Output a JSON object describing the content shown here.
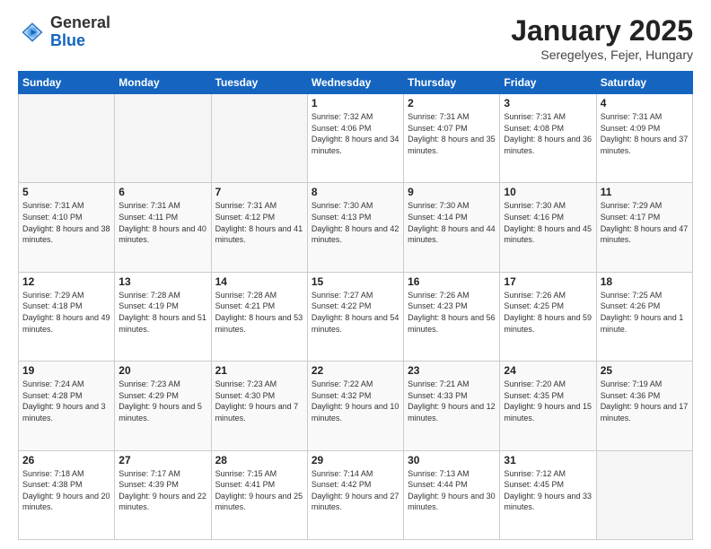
{
  "logo": {
    "general": "General",
    "blue": "Blue"
  },
  "title": "January 2025",
  "location": "Seregelyes, Fejer, Hungary",
  "days_of_week": [
    "Sunday",
    "Monday",
    "Tuesday",
    "Wednesday",
    "Thursday",
    "Friday",
    "Saturday"
  ],
  "weeks": [
    [
      {
        "num": "",
        "sunrise": "",
        "sunset": "",
        "daylight": "",
        "empty": true
      },
      {
        "num": "",
        "sunrise": "",
        "sunset": "",
        "daylight": "",
        "empty": true
      },
      {
        "num": "",
        "sunrise": "",
        "sunset": "",
        "daylight": "",
        "empty": true
      },
      {
        "num": "1",
        "sunrise": "Sunrise: 7:32 AM",
        "sunset": "Sunset: 4:06 PM",
        "daylight": "Daylight: 8 hours and 34 minutes."
      },
      {
        "num": "2",
        "sunrise": "Sunrise: 7:31 AM",
        "sunset": "Sunset: 4:07 PM",
        "daylight": "Daylight: 8 hours and 35 minutes."
      },
      {
        "num": "3",
        "sunrise": "Sunrise: 7:31 AM",
        "sunset": "Sunset: 4:08 PM",
        "daylight": "Daylight: 8 hours and 36 minutes."
      },
      {
        "num": "4",
        "sunrise": "Sunrise: 7:31 AM",
        "sunset": "Sunset: 4:09 PM",
        "daylight": "Daylight: 8 hours and 37 minutes."
      }
    ],
    [
      {
        "num": "5",
        "sunrise": "Sunrise: 7:31 AM",
        "sunset": "Sunset: 4:10 PM",
        "daylight": "Daylight: 8 hours and 38 minutes."
      },
      {
        "num": "6",
        "sunrise": "Sunrise: 7:31 AM",
        "sunset": "Sunset: 4:11 PM",
        "daylight": "Daylight: 8 hours and 40 minutes."
      },
      {
        "num": "7",
        "sunrise": "Sunrise: 7:31 AM",
        "sunset": "Sunset: 4:12 PM",
        "daylight": "Daylight: 8 hours and 41 minutes."
      },
      {
        "num": "8",
        "sunrise": "Sunrise: 7:30 AM",
        "sunset": "Sunset: 4:13 PM",
        "daylight": "Daylight: 8 hours and 42 minutes."
      },
      {
        "num": "9",
        "sunrise": "Sunrise: 7:30 AM",
        "sunset": "Sunset: 4:14 PM",
        "daylight": "Daylight: 8 hours and 44 minutes."
      },
      {
        "num": "10",
        "sunrise": "Sunrise: 7:30 AM",
        "sunset": "Sunset: 4:16 PM",
        "daylight": "Daylight: 8 hours and 45 minutes."
      },
      {
        "num": "11",
        "sunrise": "Sunrise: 7:29 AM",
        "sunset": "Sunset: 4:17 PM",
        "daylight": "Daylight: 8 hours and 47 minutes."
      }
    ],
    [
      {
        "num": "12",
        "sunrise": "Sunrise: 7:29 AM",
        "sunset": "Sunset: 4:18 PM",
        "daylight": "Daylight: 8 hours and 49 minutes."
      },
      {
        "num": "13",
        "sunrise": "Sunrise: 7:28 AM",
        "sunset": "Sunset: 4:19 PM",
        "daylight": "Daylight: 8 hours and 51 minutes."
      },
      {
        "num": "14",
        "sunrise": "Sunrise: 7:28 AM",
        "sunset": "Sunset: 4:21 PM",
        "daylight": "Daylight: 8 hours and 53 minutes."
      },
      {
        "num": "15",
        "sunrise": "Sunrise: 7:27 AM",
        "sunset": "Sunset: 4:22 PM",
        "daylight": "Daylight: 8 hours and 54 minutes."
      },
      {
        "num": "16",
        "sunrise": "Sunrise: 7:26 AM",
        "sunset": "Sunset: 4:23 PM",
        "daylight": "Daylight: 8 hours and 56 minutes."
      },
      {
        "num": "17",
        "sunrise": "Sunrise: 7:26 AM",
        "sunset": "Sunset: 4:25 PM",
        "daylight": "Daylight: 8 hours and 59 minutes."
      },
      {
        "num": "18",
        "sunrise": "Sunrise: 7:25 AM",
        "sunset": "Sunset: 4:26 PM",
        "daylight": "Daylight: 9 hours and 1 minute."
      }
    ],
    [
      {
        "num": "19",
        "sunrise": "Sunrise: 7:24 AM",
        "sunset": "Sunset: 4:28 PM",
        "daylight": "Daylight: 9 hours and 3 minutes."
      },
      {
        "num": "20",
        "sunrise": "Sunrise: 7:23 AM",
        "sunset": "Sunset: 4:29 PM",
        "daylight": "Daylight: 9 hours and 5 minutes."
      },
      {
        "num": "21",
        "sunrise": "Sunrise: 7:23 AM",
        "sunset": "Sunset: 4:30 PM",
        "daylight": "Daylight: 9 hours and 7 minutes."
      },
      {
        "num": "22",
        "sunrise": "Sunrise: 7:22 AM",
        "sunset": "Sunset: 4:32 PM",
        "daylight": "Daylight: 9 hours and 10 minutes."
      },
      {
        "num": "23",
        "sunrise": "Sunrise: 7:21 AM",
        "sunset": "Sunset: 4:33 PM",
        "daylight": "Daylight: 9 hours and 12 minutes."
      },
      {
        "num": "24",
        "sunrise": "Sunrise: 7:20 AM",
        "sunset": "Sunset: 4:35 PM",
        "daylight": "Daylight: 9 hours and 15 minutes."
      },
      {
        "num": "25",
        "sunrise": "Sunrise: 7:19 AM",
        "sunset": "Sunset: 4:36 PM",
        "daylight": "Daylight: 9 hours and 17 minutes."
      }
    ],
    [
      {
        "num": "26",
        "sunrise": "Sunrise: 7:18 AM",
        "sunset": "Sunset: 4:38 PM",
        "daylight": "Daylight: 9 hours and 20 minutes."
      },
      {
        "num": "27",
        "sunrise": "Sunrise: 7:17 AM",
        "sunset": "Sunset: 4:39 PM",
        "daylight": "Daylight: 9 hours and 22 minutes."
      },
      {
        "num": "28",
        "sunrise": "Sunrise: 7:15 AM",
        "sunset": "Sunset: 4:41 PM",
        "daylight": "Daylight: 9 hours and 25 minutes."
      },
      {
        "num": "29",
        "sunrise": "Sunrise: 7:14 AM",
        "sunset": "Sunset: 4:42 PM",
        "daylight": "Daylight: 9 hours and 27 minutes."
      },
      {
        "num": "30",
        "sunrise": "Sunrise: 7:13 AM",
        "sunset": "Sunset: 4:44 PM",
        "daylight": "Daylight: 9 hours and 30 minutes."
      },
      {
        "num": "31",
        "sunrise": "Sunrise: 7:12 AM",
        "sunset": "Sunset: 4:45 PM",
        "daylight": "Daylight: 9 hours and 33 minutes."
      },
      {
        "num": "",
        "sunrise": "",
        "sunset": "",
        "daylight": "",
        "empty": true
      }
    ]
  ]
}
